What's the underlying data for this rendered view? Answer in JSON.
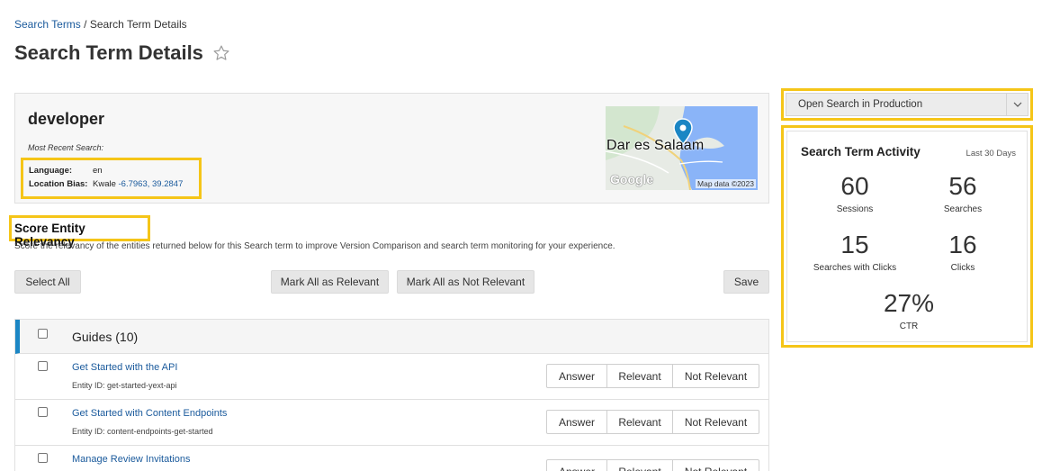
{
  "breadcrumb": {
    "parent": "Search Terms",
    "separator": " / ",
    "current": "Search Term Details"
  },
  "page": {
    "title": "Search Term Details"
  },
  "term": {
    "name": "developer",
    "recent_label": "Most Recent Search:",
    "language_label": "Language:",
    "language_value": "en",
    "location_label": "Location Bias:",
    "location_name": "Kwale",
    "location_coords": "-6.7963, 39.2847"
  },
  "map": {
    "city": "Dar es Salaam",
    "brand": "Google",
    "attribution": "Map data ©2023"
  },
  "relevancy": {
    "title": "Score Entity Relevancy",
    "description": "Score the relevancy of the entities returned below for this Search term to improve Version Comparison and search term monitoring for your experience.",
    "select_all": "Select All",
    "mark_relevant": "Mark All as Relevant",
    "mark_not_relevant": "Mark All as Not Relevant",
    "save": "Save"
  },
  "list": {
    "group_title": "Guides (10)",
    "actions": {
      "answer": "Answer",
      "relevant": "Relevant",
      "not_relevant": "Not Relevant"
    },
    "rows": [
      {
        "name": "Get Started with the API",
        "entity_id": "Entity ID: get-started-yext-api"
      },
      {
        "name": "Get Started with Content Endpoints",
        "entity_id": "Entity ID: content-endpoints-get-started"
      },
      {
        "name": "Manage Review Invitations",
        "entity_id": ""
      }
    ]
  },
  "open_search": {
    "label": "Open Search in Production"
  },
  "activity": {
    "title": "Search Term Activity",
    "range": "Last 30 Days",
    "sessions": {
      "value": "60",
      "label": "Sessions"
    },
    "searches": {
      "value": "56",
      "label": "Searches"
    },
    "searches_with_clicks": {
      "value": "15",
      "label": "Searches with Clicks"
    },
    "clicks": {
      "value": "16",
      "label": "Clicks"
    },
    "ctr": {
      "value": "27%",
      "label": "CTR"
    }
  },
  "colors": {
    "accent": "#1b86c4",
    "highlight": "#f5c518",
    "link": "#1a5a9c",
    "map_pin": "#1b86c4"
  }
}
